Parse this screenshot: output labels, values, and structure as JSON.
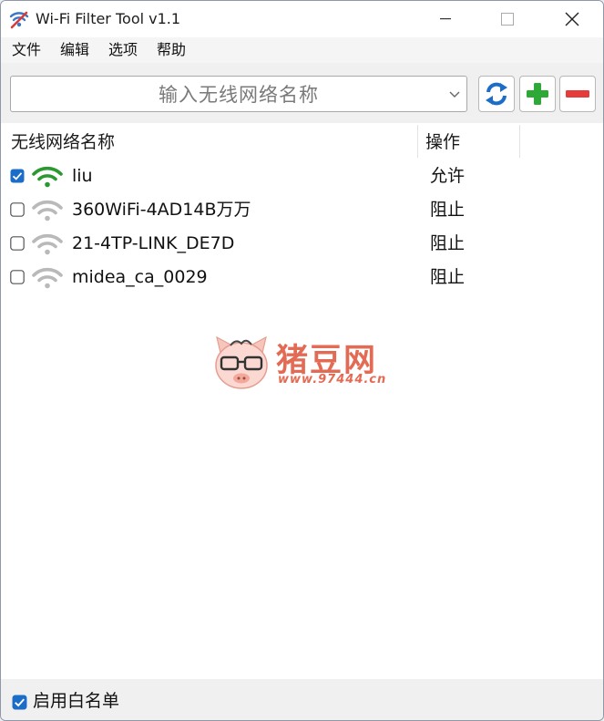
{
  "window": {
    "title": "Wi-Fi Filter Tool v1.1"
  },
  "menu": [
    "文件",
    "编辑",
    "选项",
    "帮助"
  ],
  "search": {
    "placeholder": "输入无线网络名称"
  },
  "list": {
    "columns": {
      "name": "无线网络名称",
      "action": "操作"
    },
    "rows": [
      {
        "ssid": "liu",
        "action": "允许",
        "checked": true,
        "signal": "connected"
      },
      {
        "ssid": "360WiFi-4AD14B万万",
        "action": "阻止",
        "checked": false,
        "signal": "weak"
      },
      {
        "ssid": "21-4TP-LINK_DE7D",
        "action": "阻止",
        "checked": false,
        "signal": "weak"
      },
      {
        "ssid": "midea_ca_0029",
        "action": "阻止",
        "checked": false,
        "signal": "weak"
      }
    ]
  },
  "watermark": {
    "text": "猪豆网",
    "url": "www.97444.cn"
  },
  "footer": {
    "whitelist_label": "启用白名单",
    "whitelist_checked": true
  },
  "colors": {
    "accent": "#1c6dc8",
    "add": "#2ea836",
    "remove": "#e53b3b",
    "wifi_active": "#2a9a30",
    "wifi_inactive": "#b9b9b9"
  }
}
